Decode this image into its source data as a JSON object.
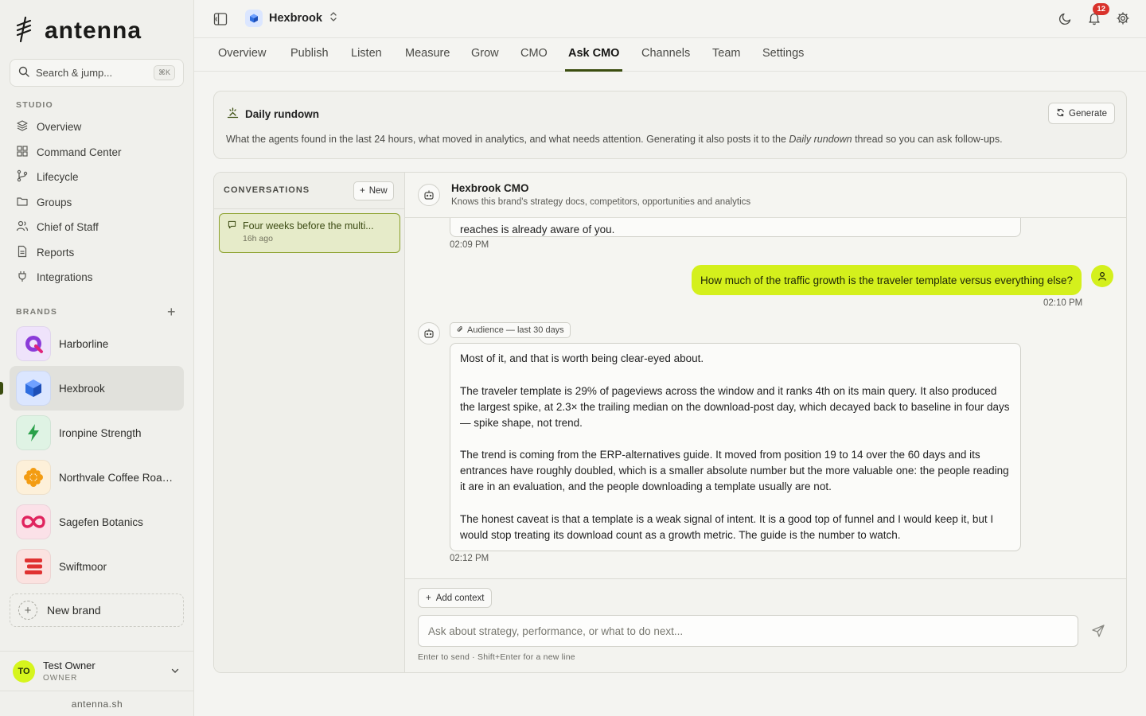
{
  "sidebar": {
    "logo_text": "antenna",
    "search": {
      "placeholder": "Search & jump...",
      "shortcut": "⌘K"
    },
    "studio_label": "STUDIO",
    "nav": [
      {
        "label": "Overview",
        "icon": "layers-icon"
      },
      {
        "label": "Command Center",
        "icon": "grid-icon"
      },
      {
        "label": "Lifecycle",
        "icon": "branch-icon"
      },
      {
        "label": "Groups",
        "icon": "folder-icon"
      },
      {
        "label": "Chief of Staff",
        "icon": "people-icon"
      },
      {
        "label": "Reports",
        "icon": "document-icon"
      },
      {
        "label": "Integrations",
        "icon": "plug-icon"
      }
    ],
    "brands_label": "BRANDS",
    "brands": [
      {
        "name": "Harborline",
        "color": "#8b3bd9",
        "bg": "#efe3fb"
      },
      {
        "name": "Hexbrook",
        "color": "#2f6ee0",
        "bg": "#dbe6ff",
        "active": true
      },
      {
        "name": "Ironpine Strength",
        "color": "#2aa04a",
        "bg": "#dff3e4"
      },
      {
        "name": "Northvale Coffee Roasters",
        "color": "#f39c12",
        "bg": "#fdf0d9"
      },
      {
        "name": "Sagefen Botanics",
        "color": "#e0245e",
        "bg": "#fbe1e8"
      },
      {
        "name": "Swiftmoor",
        "color": "#e03131",
        "bg": "#fbe2e0"
      }
    ],
    "new_brand_label": "New brand",
    "user": {
      "initials": "TO",
      "name": "Test Owner",
      "role": "OWNER"
    },
    "footer": "antenna.sh"
  },
  "topbar": {
    "brand_name": "Hexbrook",
    "notifications_count": "12"
  },
  "tabs": [
    {
      "label": "Overview"
    },
    {
      "label": "Publish"
    },
    {
      "label": "Listen"
    },
    {
      "label": "Measure"
    },
    {
      "label": "Grow"
    },
    {
      "label": "CMO"
    },
    {
      "label": "Ask CMO",
      "active": true
    },
    {
      "label": "Channels"
    },
    {
      "label": "Team"
    },
    {
      "label": "Settings"
    }
  ],
  "rundown": {
    "title": "Daily rundown",
    "generate_label": "Generate",
    "desc_before": "What the agents found in the last 24 hours, what moved in analytics, and what needs attention. Generating it also posts it to the ",
    "desc_em": "Daily rundown",
    "desc_after": " thread so you can ask follow-ups."
  },
  "conversations": {
    "header": "CONVERSATIONS",
    "new_label": "New",
    "items": [
      {
        "title": "Four weeks before the multi...",
        "time": "16h ago"
      }
    ]
  },
  "chat": {
    "agent_name": "Hexbrook CMO",
    "agent_desc": "Knows this brand's strategy docs, competitors, opportunities and analytics",
    "prev_tail": "reaches is already aware of you.",
    "prev_time": "02:09 PM",
    "user_message": "How much of the traffic growth is the traveler template versus everything else?",
    "user_time": "02:10 PM",
    "context_chip": "Audience — last 30 days",
    "bot_paragraphs": [
      "Most of it, and that is worth being clear-eyed about.",
      "The traveler template is 29% of pageviews across the window and it ranks 4th on its main query. It also produced the largest spike, at 2.3× the trailing median on the download-post day, which decayed back to baseline in four days — spike shape, not trend.",
      "The trend is coming from the ERP-alternatives guide. It moved from position 19 to 14 over the 60 days and its entrances have roughly doubled, which is a smaller absolute number but the more valuable one: the people reading it are in an evaluation, and the people downloading a template usually are not.",
      "The honest caveat is that a template is a weak signal of intent. It is a good top of funnel and I would keep it, but I would stop treating its download count as a growth metric. The guide is the number to watch."
    ],
    "bot_time": "02:12 PM"
  },
  "composer": {
    "add_context_label": "Add context",
    "placeholder": "Ask about strategy, performance, or what to do next...",
    "hint": "Enter to send · Shift+Enter for a new line"
  },
  "colors": {
    "accent": "#d4f01c",
    "accent_dark": "#3b4d10"
  }
}
